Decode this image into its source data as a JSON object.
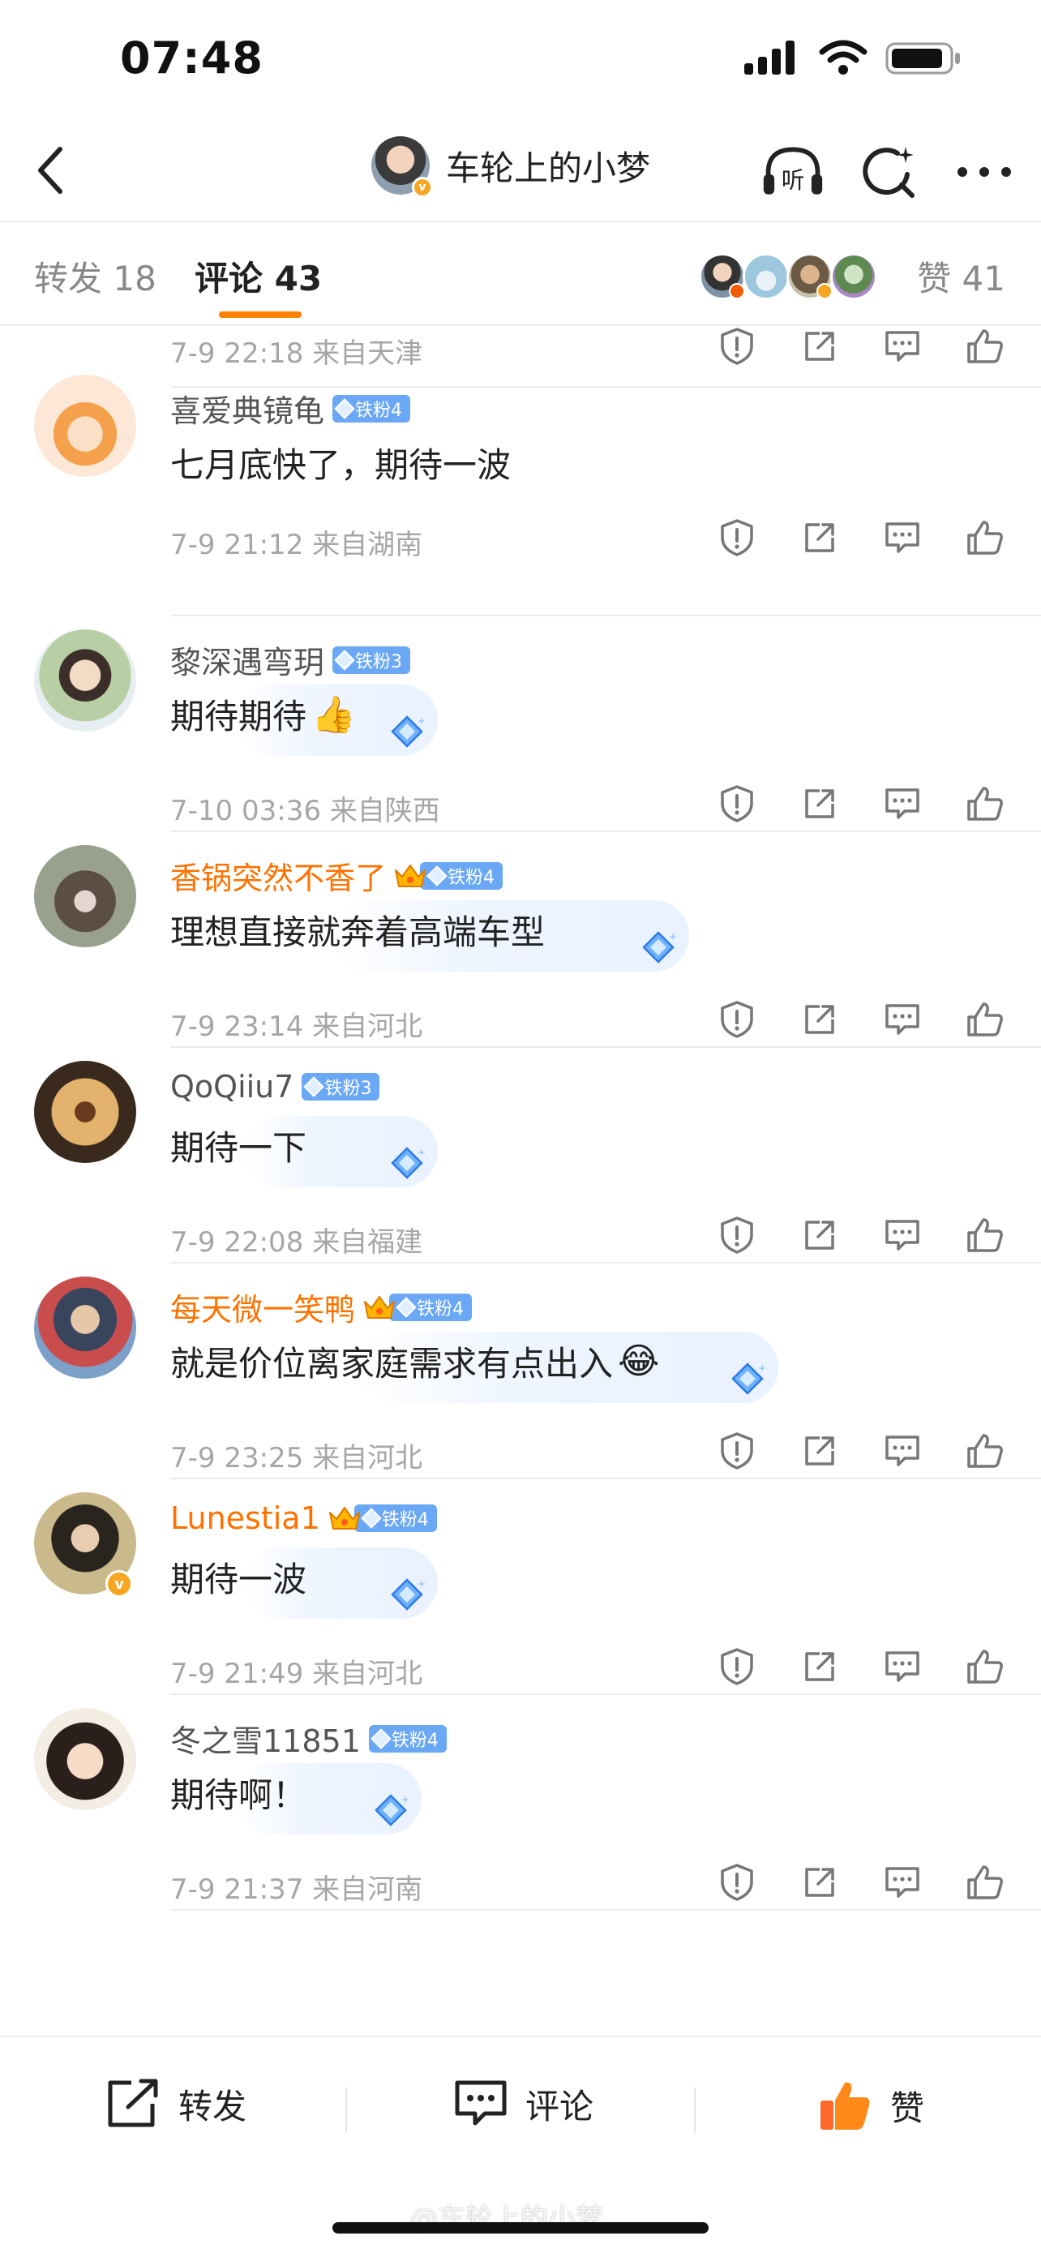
{
  "status_bar": {
    "time": "07:48",
    "icons": [
      "signal-icon",
      "wifi-icon",
      "battery-icon"
    ]
  },
  "nav": {
    "title": "车轮上的小梦",
    "verified_badge": "v",
    "listen_label": "听",
    "icons": [
      "back-icon",
      "listen-icon",
      "search-icon",
      "more-icon"
    ]
  },
  "tabs": {
    "repost": "转发 18",
    "comment": "评论 43",
    "likes": "赞 41"
  },
  "partial_comment": {
    "meta": "7-9 22:18  来自天津"
  },
  "comments": [
    {
      "name": "喜爱典镜龟",
      "vip": false,
      "fan_badge": "铁粉4",
      "text": "七月底快了，期待一波",
      "emoji": "",
      "meta": "7-9 21:12  来自湖南"
    },
    {
      "name": "黎深遇弯玥",
      "vip": false,
      "fan_badge": "铁粉3",
      "text": "期待期待",
      "emoji": "👍",
      "meta": "7-10 03:36  来自陕西"
    },
    {
      "name": "香锅突然不香了",
      "vip": true,
      "fan_badge": "铁粉4",
      "text": "理想直接就奔着高端车型",
      "emoji": "",
      "meta": "7-9 23:14  来自河北"
    },
    {
      "name": "QoQiiu7",
      "vip": false,
      "fan_badge": "铁粉3",
      "text": "期待一下",
      "emoji": "",
      "meta": "7-9 22:08  来自福建"
    },
    {
      "name": "每天微一笑鸭",
      "vip": true,
      "fan_badge": "铁粉4",
      "text": "就是价位离家庭需求有点出入",
      "emoji": "😂",
      "meta": "7-9 23:25  来自河北"
    },
    {
      "name": "Lunestia1",
      "vip": true,
      "fan_badge": "铁粉4",
      "text": "期待一波",
      "emoji": "",
      "meta": "7-9 21:49  来自河北"
    },
    {
      "name": "冬之雪11851",
      "vip": false,
      "fan_badge": "铁粉4",
      "text": "期待啊！",
      "emoji": "",
      "meta": "7-9 21:37  来自河南"
    }
  ],
  "bottom_bar": {
    "repost": "转发",
    "comment": "评论",
    "like": "赞"
  },
  "watermark": "@车轮上的小梦",
  "colors": {
    "accent": "#ff8200",
    "vip_name": "#ff7200",
    "fan_badge": "#6aa7f4",
    "meta": "#a6a6a6"
  }
}
